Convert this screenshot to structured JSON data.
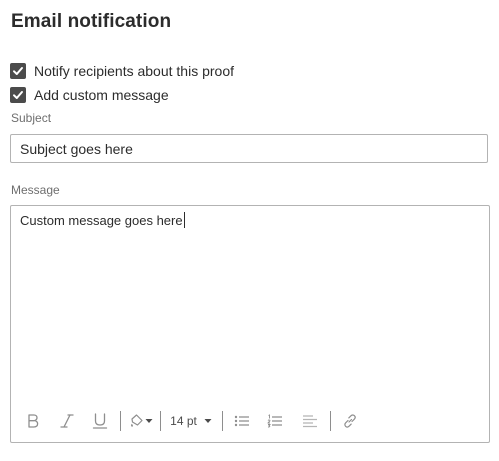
{
  "header": {
    "title": "Email notification"
  },
  "options": {
    "notify_label": "Notify recipients about this proof",
    "notify_checked": true,
    "custom_message_label": "Add custom message",
    "custom_message_checked": true
  },
  "subject": {
    "label": "Subject",
    "value": "Subject goes here"
  },
  "message": {
    "label": "Message",
    "value": "Custom message goes here"
  },
  "toolbar": {
    "font_size": "14 pt",
    "icons": [
      "bold-icon",
      "italic-icon",
      "underline-icon",
      "text-color-icon",
      "bulleted-list-icon",
      "numbered-list-icon",
      "align-icon",
      "link-icon"
    ]
  },
  "colors": {
    "checkbox_fill": "#4b4b4b",
    "border": "#b3b3b3",
    "toolbar_icon": "#8e8e8e",
    "text": "#2c2c2c",
    "label": "#6e6e6e"
  }
}
